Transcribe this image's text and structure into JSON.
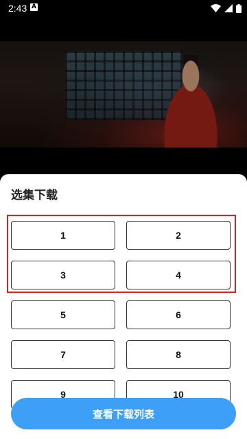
{
  "status_bar": {
    "time": "2:43",
    "notification_glyph": "A",
    "icons": [
      "wifi-icon",
      "signal-icon",
      "battery-icon"
    ]
  },
  "sheet": {
    "title": "选集下载",
    "episodes": [
      "1",
      "2",
      "3",
      "4",
      "5",
      "6",
      "7",
      "8",
      "9",
      "10"
    ],
    "view_downloads_label": "查看下载列表"
  },
  "colors": {
    "primary_button": "#3d9ff5",
    "highlight_border": "#d91e1e",
    "sheet_background": "#ffffff"
  }
}
